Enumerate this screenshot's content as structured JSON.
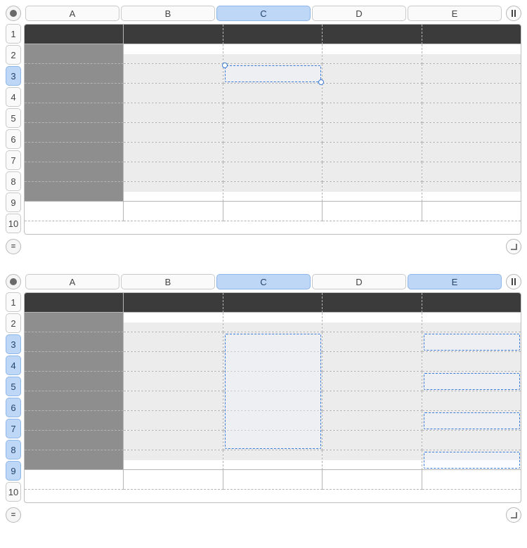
{
  "columns": [
    "A",
    "B",
    "C",
    "D",
    "E"
  ],
  "rows": [
    "1",
    "2",
    "3",
    "4",
    "5",
    "6",
    "7",
    "8",
    "9",
    "10"
  ],
  "sheet1": {
    "selected_columns": [
      "C"
    ],
    "selected_rows": [
      "3"
    ],
    "selection": {
      "top_row": 3,
      "bottom_row": 3,
      "left_col": "C",
      "right_col": "C",
      "handles": true
    }
  },
  "sheet2": {
    "selected_columns": [
      "C",
      "E"
    ],
    "selected_rows": [
      "3",
      "4",
      "5",
      "6",
      "7",
      "8",
      "9"
    ],
    "selections": [
      {
        "top_row": 3,
        "bottom_row": 8,
        "left_col": "C",
        "right_col": "C"
      },
      {
        "top_row": 3,
        "bottom_row": 3,
        "left_col": "E",
        "right_col": "E"
      },
      {
        "top_row": 5,
        "bottom_row": 5,
        "left_col": "E",
        "right_col": "E"
      },
      {
        "top_row": 7,
        "bottom_row": 7,
        "left_col": "E",
        "right_col": "E"
      },
      {
        "top_row": 9,
        "bottom_row": 9,
        "left_col": "E",
        "right_col": "E"
      }
    ]
  },
  "icons": {
    "record": "record-icon",
    "pause": "pause-icon",
    "equals": "equals-icon",
    "corner": "corner-icon"
  }
}
